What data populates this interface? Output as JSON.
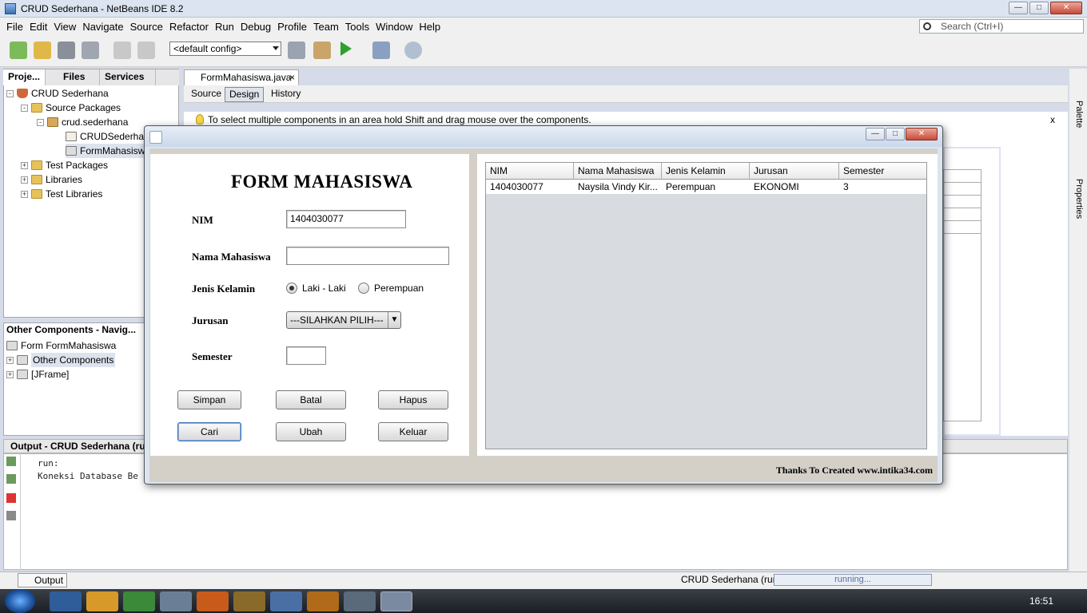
{
  "ide": {
    "title": "CRUD Sederhana - NetBeans IDE 8.2",
    "menu": [
      "File",
      "Edit",
      "View",
      "Navigate",
      "Source",
      "Refactor",
      "Run",
      "Debug",
      "Profile",
      "Team",
      "Tools",
      "Window",
      "Help"
    ],
    "search_placeholder": "Search (Ctrl+I)",
    "config": "<default config>"
  },
  "projects_panel": {
    "tabs": [
      "Proje...",
      "Files",
      "Services"
    ],
    "tree": {
      "root": "CRUD Sederhana",
      "source_packages": "Source Packages",
      "package": "crud.sederhana",
      "file1": "CRUDSederhana",
      "file2": "FormMahasiswa.",
      "test_packages": "Test Packages",
      "libraries": "Libraries",
      "test_libraries": "Test Libraries"
    }
  },
  "navigator": {
    "title": "Other Components - Navig...",
    "items": [
      "Form FormMahasiswa",
      "Other Components",
      "[JFrame]"
    ]
  },
  "editor": {
    "tab": "FormMahasiswa.java",
    "modes": [
      "Source",
      "Design",
      "History"
    ],
    "hint": "To select multiple components in an area hold Shift and drag mouse over the components.",
    "hint_close": "x"
  },
  "output": {
    "title": "Output - CRUD Sederhana (run)",
    "lines": [
      "run:",
      "Koneksi Database Be"
    ]
  },
  "statusbar": {
    "output_tab": "Output",
    "run_label": "CRUD Sederhana (run)",
    "progress_text": "running..."
  },
  "right_rail": [
    "Palette",
    "Properties"
  ],
  "taskbar": {
    "clock": "16:51"
  },
  "form": {
    "title": "FORM MAHASISWA",
    "labels": {
      "nim": "NIM",
      "nama": "Nama Mahasiswa",
      "jk": "Jenis Kelamin",
      "jurusan": "Jurusan",
      "semester": "Semester"
    },
    "nim_value": "1404030077",
    "nama_value": "",
    "semester_value": "",
    "radio_male": "Laki - Laki",
    "radio_female": "Perempuan",
    "jurusan_selected": "---SILAHKAN PILIH---",
    "buttons": {
      "simpan": "Simpan",
      "batal": "Batal",
      "hapus": "Hapus",
      "cari": "Cari",
      "ubah": "Ubah",
      "keluar": "Keluar"
    },
    "footer": "Thanks To Created www.intika34.com"
  },
  "table": {
    "headers": [
      "NIM",
      "Nama Mahasiswa",
      "Jenis Kelamin",
      "Jurusan",
      "Semester"
    ],
    "rows": [
      [
        "1404030077",
        "Naysila Vindy Kir...",
        "Perempuan",
        "EKONOMI",
        "3"
      ]
    ]
  }
}
